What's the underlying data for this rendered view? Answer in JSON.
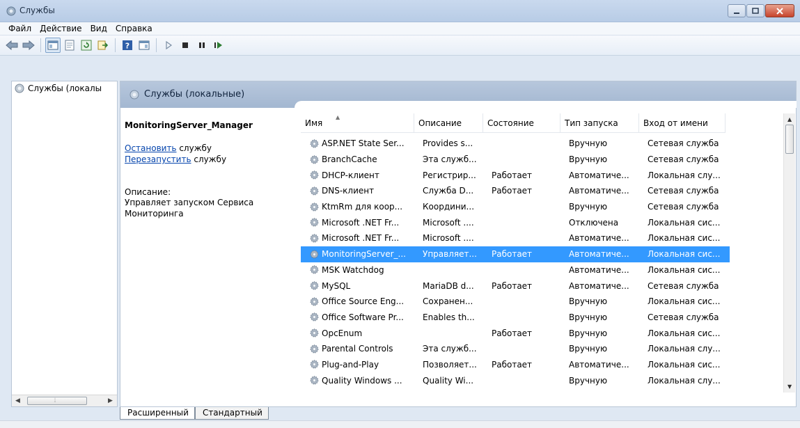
{
  "window": {
    "title": "Службы"
  },
  "menu": {
    "items": [
      {
        "label": "Файл"
      },
      {
        "label": "Действие"
      },
      {
        "label": "Вид"
      },
      {
        "label": "Справка"
      }
    ]
  },
  "toolbar": {
    "buttons": [
      "back-arrow-icon",
      "forward-arrow-icon",
      "console-tree-icon",
      "properties-icon",
      "refresh-icon",
      "export-icon",
      "help-icon",
      "action-pane-icon",
      "start-icon",
      "stop-icon",
      "pause-icon",
      "restart-icon"
    ]
  },
  "tree": {
    "root_label": "Службы (локалы"
  },
  "pane": {
    "header_title": "Службы (локальные)",
    "selected_service": "MonitoringServer_Manager",
    "stop_link": "Остановить",
    "stop_suffix": " службу",
    "restart_link": "Перезапустить",
    "restart_suffix": " службу",
    "description_label": "Описание:",
    "description_text": "Управляет запуском Сервиса Мониторинга"
  },
  "table": {
    "columns": [
      "Имя",
      "Описание",
      "Состояние",
      "Тип запуска",
      "Вход от имени"
    ],
    "rows": [
      {
        "name": "ASP.NET State Ser...",
        "desc": "Provides s...",
        "state": "",
        "start": "Вручную",
        "logon": "Сетевая служба"
      },
      {
        "name": "BranchCache",
        "desc": "Эта служб...",
        "state": "",
        "start": "Вручную",
        "logon": "Сетевая служба"
      },
      {
        "name": "DHCP-клиент",
        "desc": "Регистрир...",
        "state": "Работает",
        "start": "Автоматиче...",
        "logon": "Локальная слу..."
      },
      {
        "name": "DNS-клиент",
        "desc": "Служба D...",
        "state": "Работает",
        "start": "Автоматиче...",
        "logon": "Сетевая служба"
      },
      {
        "name": "KtmRm для коор...",
        "desc": "Координи...",
        "state": "",
        "start": "Вручную",
        "logon": "Сетевая служба"
      },
      {
        "name": "Microsoft .NET Fr...",
        "desc": "Microsoft ....",
        "state": "",
        "start": "Отключена",
        "logon": "Локальная сис..."
      },
      {
        "name": "Microsoft .NET Fr...",
        "desc": "Microsoft ....",
        "state": "",
        "start": "Автоматиче...",
        "logon": "Локальная сис..."
      },
      {
        "name": "MonitoringServer_...",
        "desc": "Управляет...",
        "state": "Работает",
        "start": "Автоматиче...",
        "logon": "Локальная сис..."
      },
      {
        "name": "MSK Watchdog",
        "desc": "",
        "state": "",
        "start": "Автоматиче...",
        "logon": "Локальная сис..."
      },
      {
        "name": "MySQL",
        "desc": "MariaDB d...",
        "state": "Работает",
        "start": "Автоматиче...",
        "logon": "Сетевая служба"
      },
      {
        "name": "Office  Source Eng...",
        "desc": "Сохранен...",
        "state": "",
        "start": "Вручную",
        "logon": "Локальная сис..."
      },
      {
        "name": "Office Software Pr...",
        "desc": "Enables th...",
        "state": "",
        "start": "Вручную",
        "logon": "Сетевая служба"
      },
      {
        "name": "OpcEnum",
        "desc": "",
        "state": "Работает",
        "start": "Вручную",
        "logon": "Локальная сис..."
      },
      {
        "name": "Parental Controls",
        "desc": "Эта служб...",
        "state": "",
        "start": "Вручную",
        "logon": "Локальная слу..."
      },
      {
        "name": "Plug-and-Play",
        "desc": "Позволяет...",
        "state": "Работает",
        "start": "Автоматиче...",
        "logon": "Локальная сис..."
      },
      {
        "name": "Quality Windows ...",
        "desc": "Quality Wi...",
        "state": "",
        "start": "Вручную",
        "logon": "Локальная слу..."
      }
    ],
    "selected_index": 7
  },
  "tabs": [
    {
      "label": "Расширенный"
    },
    {
      "label": "Стандартный"
    }
  ],
  "colors": {
    "selection": "#3399ff",
    "header_band": "#a3b7d1",
    "link": "#0645ad"
  }
}
